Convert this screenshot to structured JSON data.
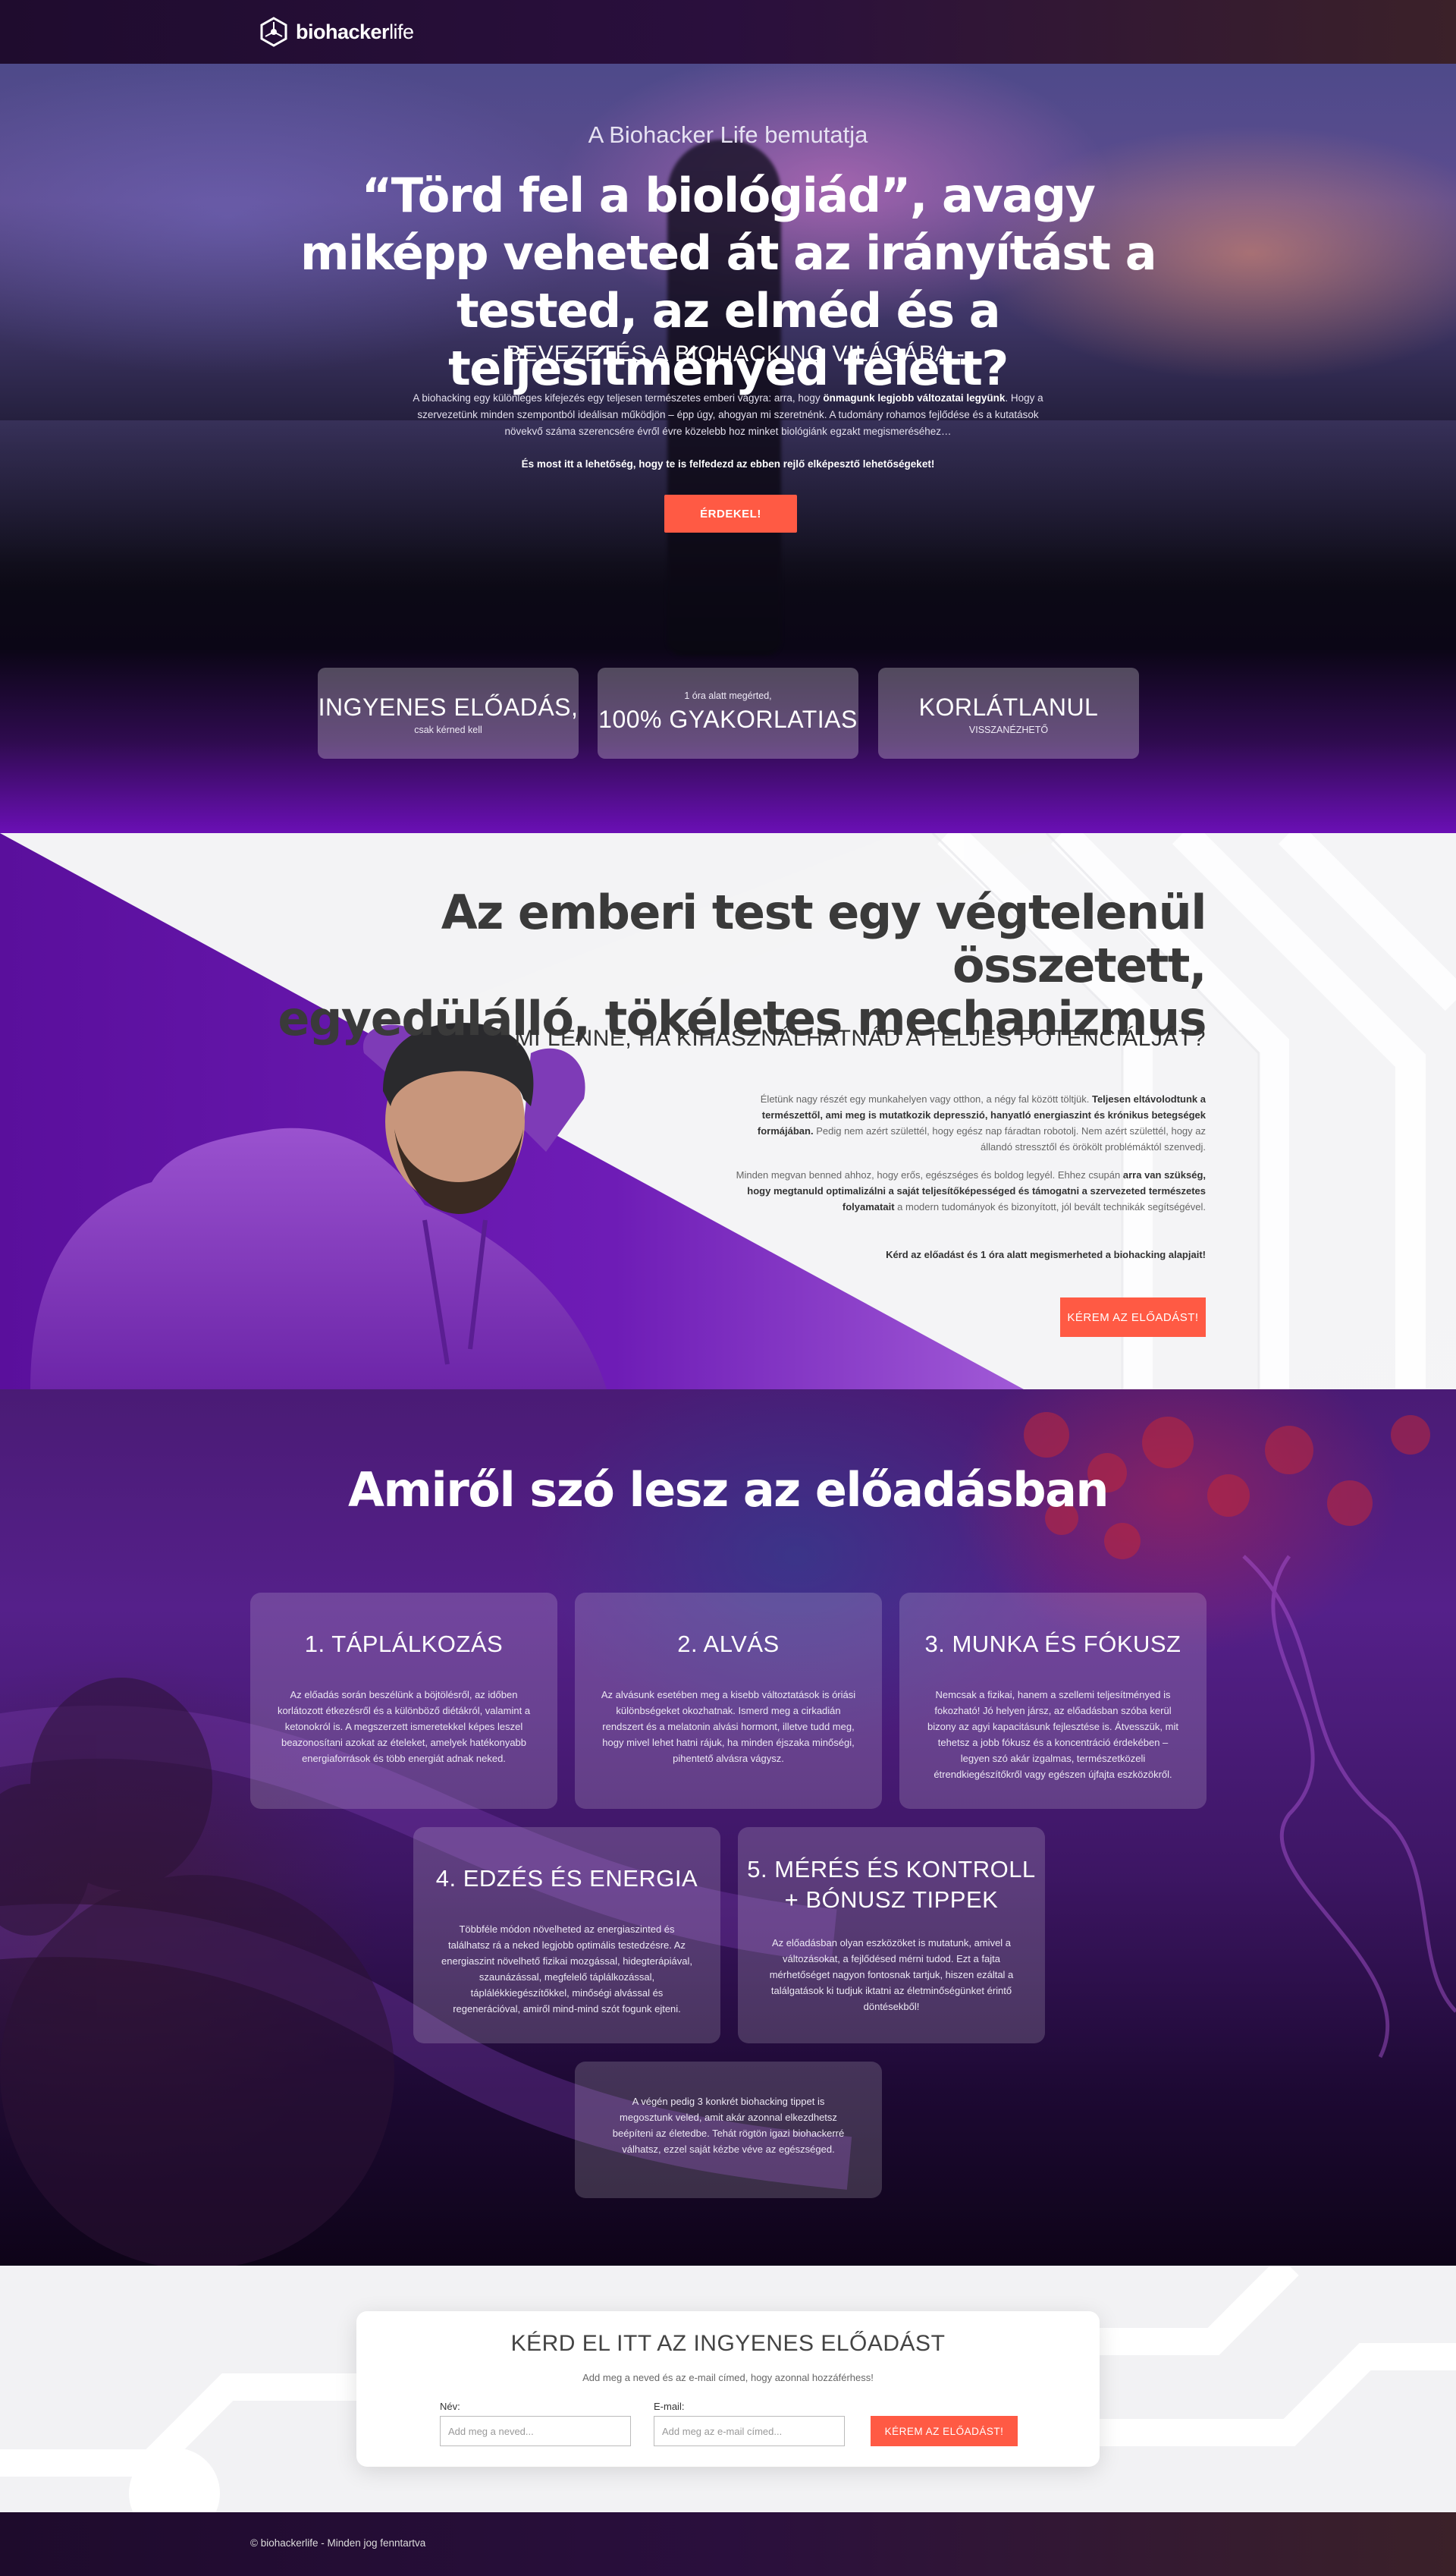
{
  "nav": {
    "logo_bold": "biohacker",
    "logo_light": "life"
  },
  "hero": {
    "eyebrow": "A Biohacker Life bemutatja",
    "title": "“Törd fel a biológiád”, avagy miképp veheted át az irányítást a tested, az elméd és a teljesítményed felett?",
    "subtitle": "- BEVEZETÉS A BIOHACKING VILÁGÁBA -",
    "desc_pre": "A biohacking egy különleges kifejezés egy teljesen természetes emberi vágyra: arra, hogy ",
    "desc_bold": "önmagunk legjobb változatai legyünk",
    "desc_post": ". Hogy a szervezetünk minden szempontból ideálisan működjön – épp úgy, ahogyan mi szeretnénk. A tudomány rohamos fejlődése és a kutatások növekvő száma szerencsére évről évre közelebb hoz minket biológiánk egzakt megismeréséhez…",
    "cta_text": "És most itt a lehetőség, hogy te is felfedezd az ebben rejlő elképesztő lehetőségeket!",
    "button": "ÉRDEKEL!",
    "features": [
      {
        "big": "INGYENES ELŐADÁS,",
        "small": "csak kérned kell"
      },
      {
        "small": "1 óra alatt megérted,",
        "big": "100% GYAKORLATIAS"
      },
      {
        "big": "KORLÁTLANUL",
        "small": "VISSZANÉZHETŐ"
      }
    ]
  },
  "section2": {
    "title_line1": "Az emberi test egy végtelenül összetett,",
    "title_line2": "egyedülálló, tökéletes mechanizmus",
    "subtitle": "MI LENNE, HA KIHASZNÁLHATNÁD A TELJES POTENCIÁLJÁT?",
    "p1_pre": "Életünk nagy részét egy munkahelyen vagy otthon, a négy fal között töltjük. ",
    "p1_bold": "Teljesen eltávolodtunk a természettől, ami meg is mutatkozik depresszió, hanyatló energiaszint és krónikus betegségek formájában.",
    "p1_post": " Pedig nem azért születtél, hogy egész nap fáradtan robotolj. Nem azért születtél, hogy az állandó stressztől és örökölt problémáktól szenvedj.",
    "p2_pre": "Minden megvan benned ahhoz, hogy erős, egészséges és boldog legyél. Ehhez csupán ",
    "p2_bold": "arra van szükség, hogy megtanuld optimalizálni a saját teljesítőképességed és támogatni a szervezeted természetes folyamatait",
    "p2_post": " a modern tudományok és bizonyított, jól bevált technikák segítségével.",
    "bold_line": "Kérd az előadást és 1 óra alatt megismerheted a biohacking alapjait!",
    "button": "KÉREM AZ ELŐADÁST!"
  },
  "section3": {
    "title": "Amiről szó lesz az előadásban",
    "cards": [
      {
        "title": "1. TÁPLÁLKOZÁS",
        "text": "Az előadás során beszélünk a böjtölésről, az időben korlátozott étkezésről és a különböző diétákról, valamint a ketonokról is. A megszerzett ismeretekkel képes leszel beazonosítani azokat az ételeket, amelyek hatékonyabb energiaforrások és több energiát adnak neked."
      },
      {
        "title": "2. ALVÁS",
        "text": "Az alvásunk esetében meg a kisebb változtatások is óriási különbségeket okozhatnak. Ismerd meg a cirkadián rendszert és a melatonin alvási hormont, illetve tudd meg, hogy mivel lehet hatni rájuk, ha minden éjszaka minőségi, pihentető alvásra vágysz."
      },
      {
        "title": "3. MUNKA ÉS FÓKUSZ",
        "text": "Nemcsak a fizikai, hanem a szellemi teljesítményed is fokozható! Jó helyen jársz, az előadásban szóba kerül bizony az agyi kapacitásunk fejlesztése is. Átvesszük, mit tehetsz a jobb fókusz és a koncentráció érdekében – legyen szó akár izgalmas, természetközeli étrendkiegészítőkről vagy egészen újfajta eszközökről."
      },
      {
        "title": "4. EDZÉS ÉS ENERGIA",
        "text": "Többféle módon növelheted az energiaszinted és találhatsz rá a neked legjobb optimális testedzésre. Az energiaszint növelhető fizikai mozgással, hidegterápiával, szaunázással, megfelelő táplálkozással, táplálékkiegészítőkkel, minőségi alvással és regenerációval, amiről mind-mind szót fogunk ejteni."
      },
      {
        "title_line1": "5. MÉRÉS ÉS KONTROLL",
        "title_line2": "+ BÓNUSZ TIPPEK",
        "text": "Az előadásban olyan eszközöket is mutatunk, amivel a változásokat, a fejlődésed mérni tudod. Ezt a fajta mérhetőséget nagyon fontosnak tartjuk, hiszen ezáltal a találgatások ki tudjuk iktatni az életminőségünket érintő döntésekből!"
      },
      {
        "text": "A végén pedig 3 konkrét biohacking tippet is megosztunk veled, amit akár azonnal elkezdhetsz beépíteni az életedbe. Tehát rögtön igazi biohackerré válhatsz, ezzel saját kézbe véve az egészséged."
      }
    ]
  },
  "signup": {
    "title": "KÉRD EL ITT AZ INGYENES ELŐADÁST",
    "subtitle": "Add meg a neved és az e-mail címed, hogy azonnal hozzáférhess!",
    "name_label": "Név:",
    "name_placeholder": "Add meg a neved...",
    "email_label": "E-mail:",
    "email_placeholder": "Add meg az e-mail címed...",
    "button": "KÉREM AZ ELŐADÁST!"
  },
  "footer": {
    "text": "© biohackerlife - Minden jog fenntartva"
  },
  "colors": {
    "accent": "#ff5a44",
    "purple": "#6a0fb5",
    "dark": "#1f0c2e"
  },
  "icons": {
    "logo": "hexagon-molecule-icon"
  }
}
